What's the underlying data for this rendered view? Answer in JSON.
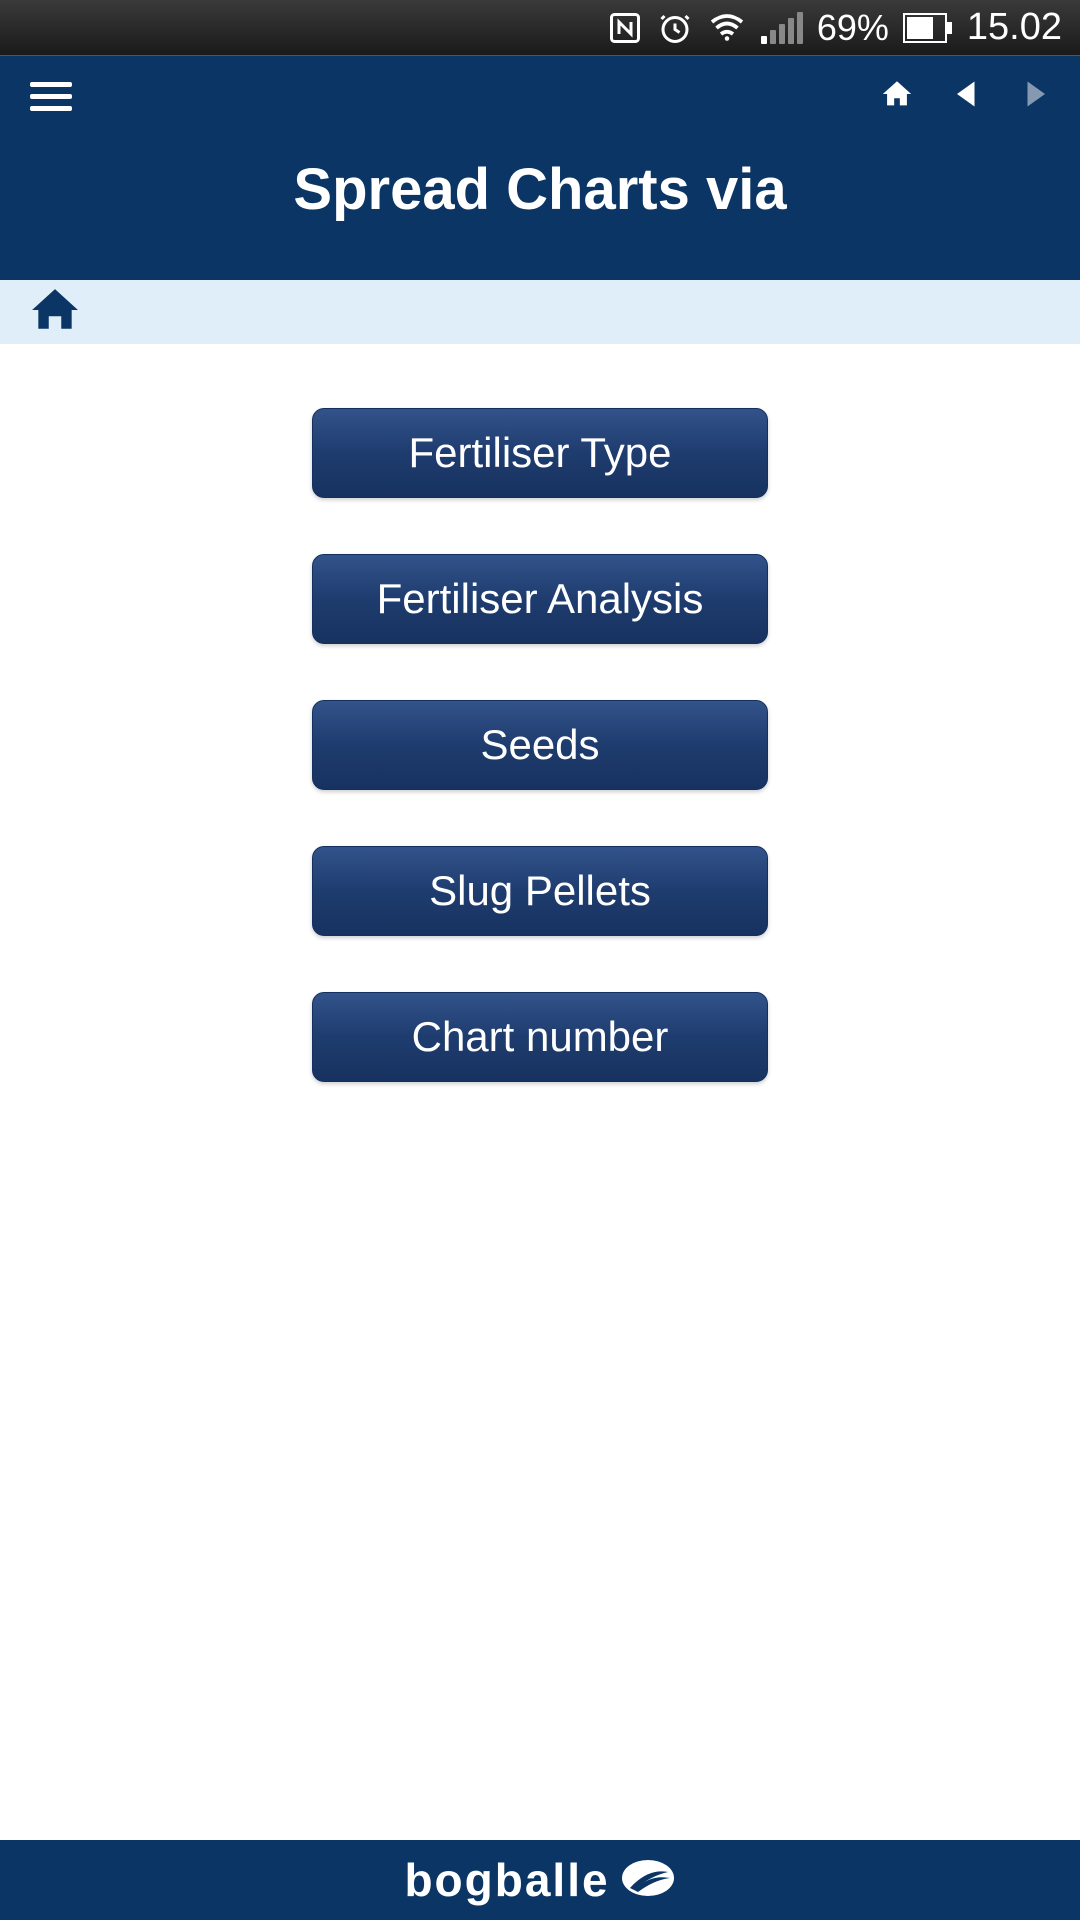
{
  "status_bar": {
    "battery_percent": "69%",
    "time": "15.02"
  },
  "header": {
    "title": "Spread Charts via"
  },
  "menu": {
    "items": [
      {
        "label": "Fertiliser Type"
      },
      {
        "label": "Fertiliser Analysis"
      },
      {
        "label": "Seeds"
      },
      {
        "label": "Slug Pellets"
      },
      {
        "label": "Chart number"
      }
    ]
  },
  "footer": {
    "brand": "bogballe"
  }
}
